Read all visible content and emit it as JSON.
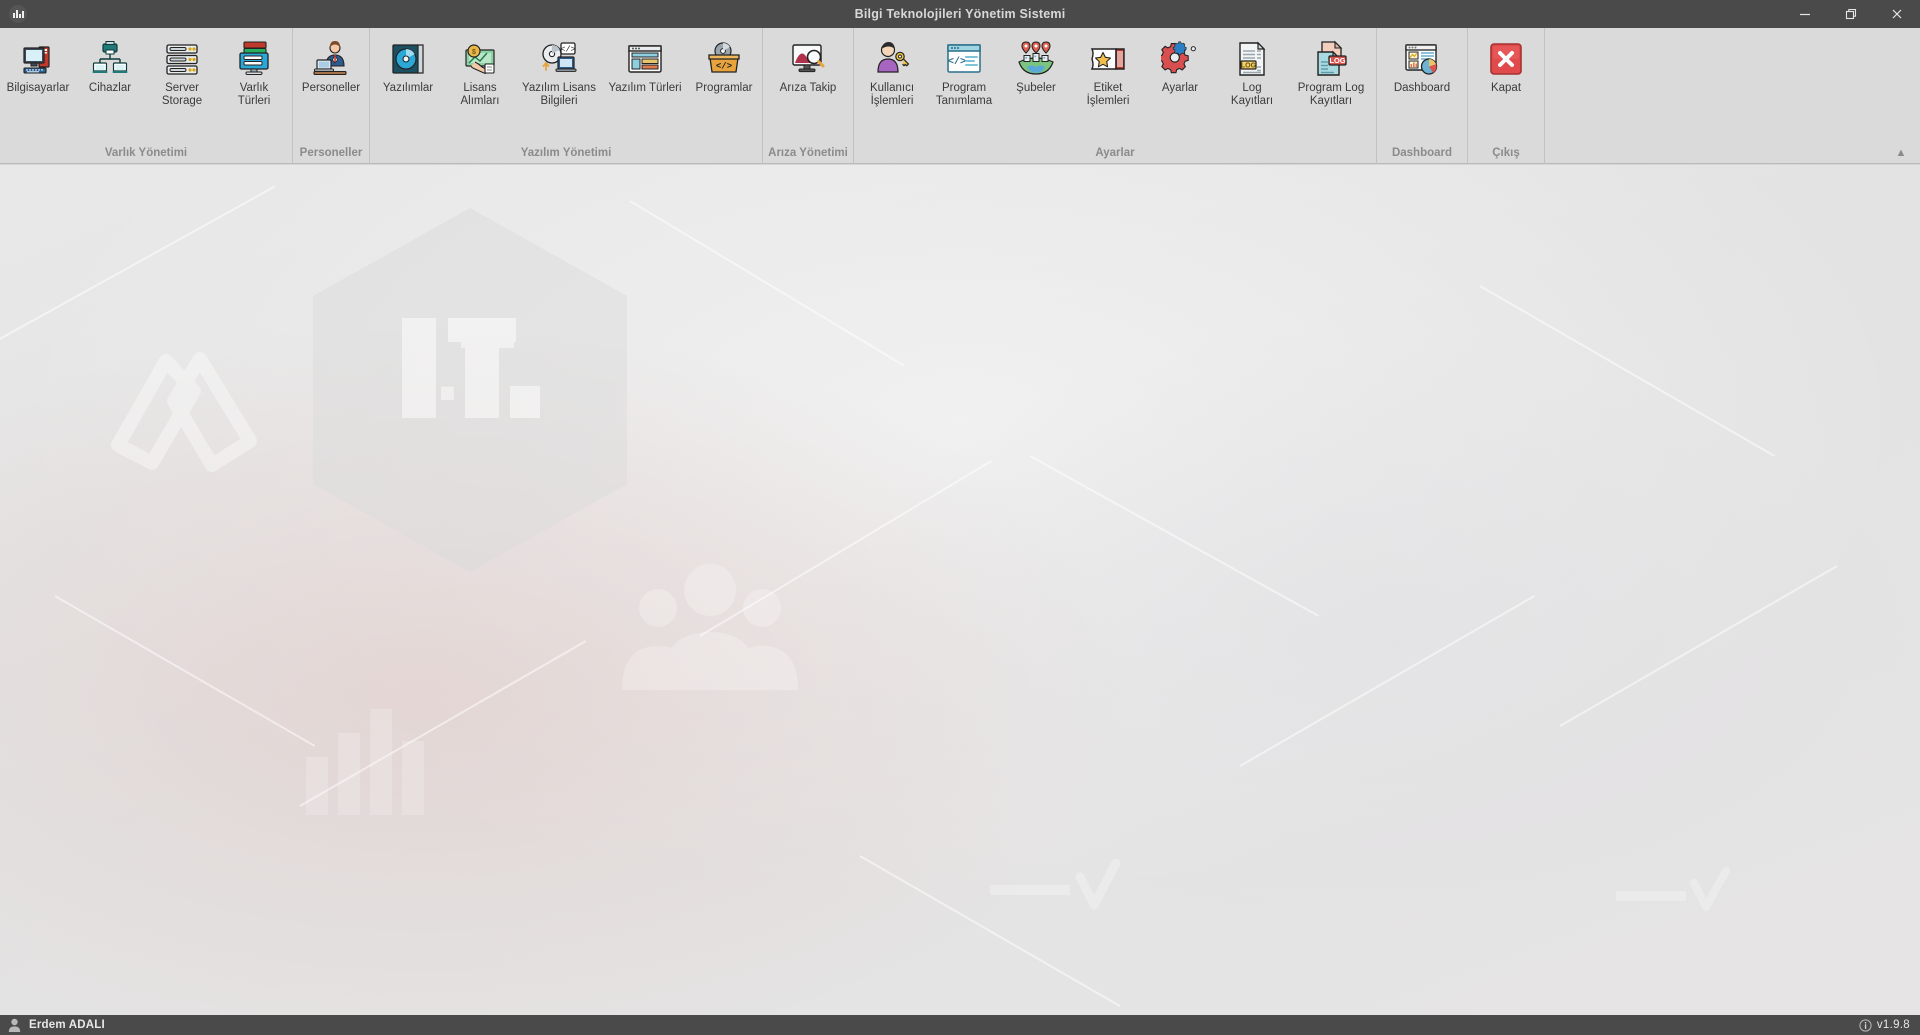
{
  "window": {
    "title": "Bilgi Teknolojileri Yönetim Sistemi",
    "app_icon": "chart-bars-icon",
    "controls": {
      "minimize": "minimize-icon",
      "restore": "restore-icon",
      "close": "close-icon"
    }
  },
  "ribbon": {
    "collapse_glyph": "▲",
    "groups": [
      {
        "label": "Varlık Yönetimi",
        "items": [
          {
            "label": "Bilgisayarlar",
            "icon": "computer-icon"
          },
          {
            "label": "Cihazlar",
            "icon": "devices-network-icon"
          },
          {
            "label": "Server\nStorage",
            "icon": "server-storage-icon"
          },
          {
            "label": "Varlık\nTürleri",
            "icon": "asset-types-icon"
          }
        ]
      },
      {
        "label": "Personeller",
        "items": [
          {
            "label": "Personeller",
            "icon": "staff-person-icon"
          }
        ]
      },
      {
        "label": "Yazılım Yönetimi",
        "items": [
          {
            "label": "Yazılımlar",
            "icon": "software-cd-icon"
          },
          {
            "label": "Lisans\nAlımları",
            "icon": "license-purchase-icon"
          },
          {
            "label": "Yazılım Lisans\nBilgileri",
            "icon": "software-license-info-icon"
          },
          {
            "label": "Yazılım Türleri",
            "icon": "software-types-window-icon"
          },
          {
            "label": "Programlar",
            "icon": "programs-box-icon"
          }
        ]
      },
      {
        "label": "Arıza Yönetimi",
        "items": [
          {
            "label": "Arıza Takip",
            "icon": "fault-tracking-icon"
          }
        ]
      },
      {
        "label": "Ayarlar",
        "items": [
          {
            "label": "Kullanıcı\nİşlemleri",
            "icon": "user-key-icon"
          },
          {
            "label": "Program\nTanımlama",
            "icon": "program-definition-icon"
          },
          {
            "label": "Şubeler",
            "icon": "branches-map-icon"
          },
          {
            "label": "Etiket\nİşlemleri",
            "icon": "label-ticket-icon"
          },
          {
            "label": "Ayarlar",
            "icon": "gear-settings-icon"
          },
          {
            "label": "Log\nKayıtları",
            "icon": "log-records-icon"
          },
          {
            "label": "Program Log\nKayıtları",
            "icon": "program-log-records-icon"
          }
        ]
      },
      {
        "label": "Dashboard",
        "items": [
          {
            "label": "Dashboard",
            "icon": "dashboard-chart-icon"
          }
        ]
      },
      {
        "label": "Çıkış",
        "items": [
          {
            "label": "Kapat",
            "icon": "close-red-icon"
          }
        ]
      }
    ]
  },
  "workspace": {
    "watermark_text": "I.T.",
    "watermark_shape": "hexagon-logo"
  },
  "statusbar": {
    "user_icon": "user-icon",
    "user": "Erdem ADALI",
    "info_icon": "info-icon",
    "version": "v1.9.8"
  },
  "colors": {
    "titlebar": "#4a4a4a",
    "ribbon": "#dadada",
    "workspace": "#e6e6e6",
    "statusbar": "#4a4a4a",
    "close_accent": "#e04a4a"
  }
}
